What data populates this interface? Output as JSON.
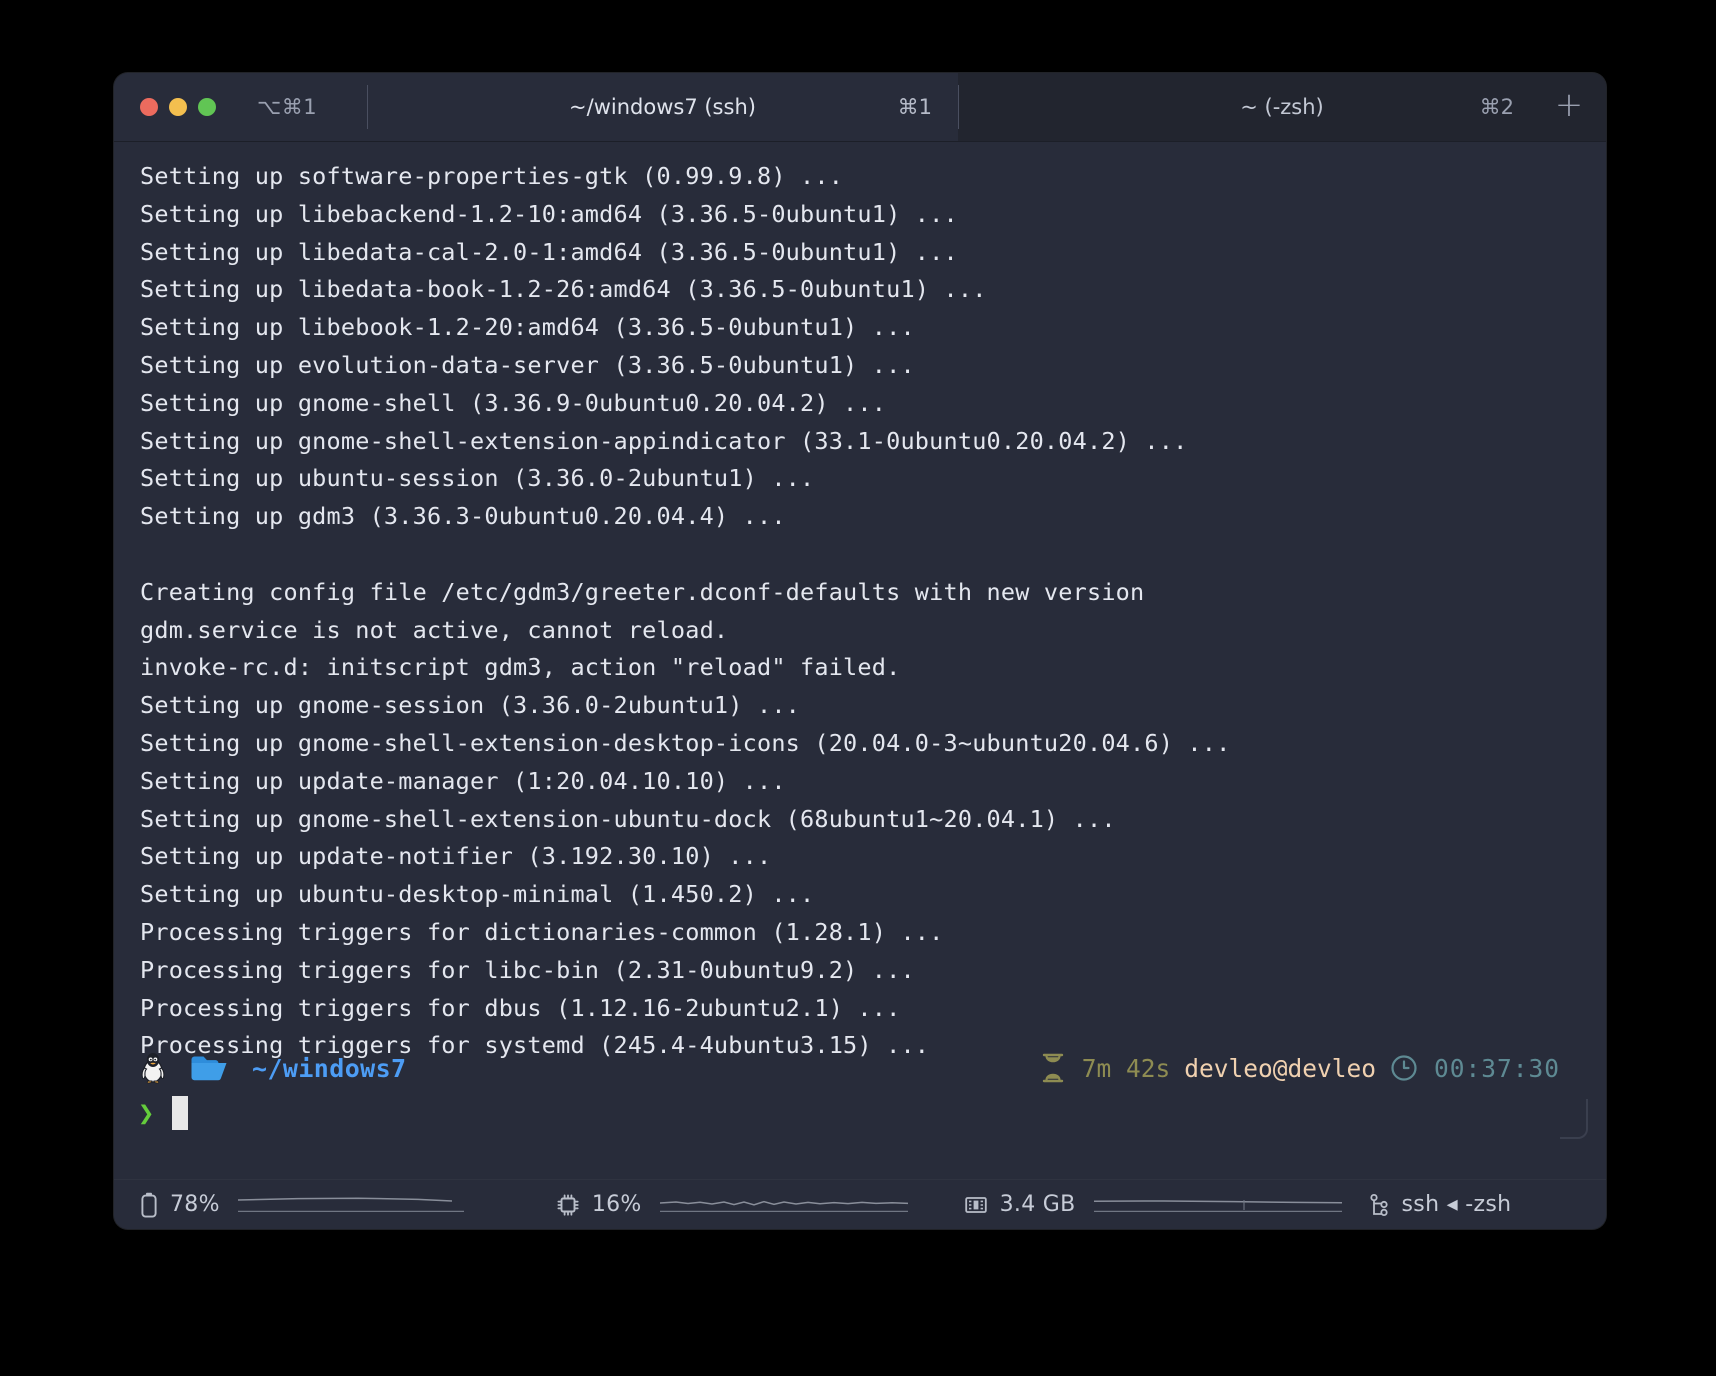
{
  "window": {
    "traffic_lights": [
      {
        "name": "close",
        "color": "#ec6b5e"
      },
      {
        "name": "minimize",
        "color": "#f3bf4f"
      },
      {
        "name": "zoom",
        "color": "#61c554"
      }
    ],
    "window_shortcut": "⌥⌘1",
    "background": "#282c3a"
  },
  "tabs": [
    {
      "title": "~/windows7 (ssh)",
      "shortcut": "⌘1",
      "active": true
    },
    {
      "title": "~ (-zsh)",
      "shortcut": "⌘2",
      "active": false
    }
  ],
  "new_tab_label": "+",
  "terminal": {
    "lines": [
      "Setting up software-properties-gtk (0.99.9.8) ...",
      "Setting up libebackend-1.2-10:amd64 (3.36.5-0ubuntu1) ...",
      "Setting up libedata-cal-2.0-1:amd64 (3.36.5-0ubuntu1) ...",
      "Setting up libedata-book-1.2-26:amd64 (3.36.5-0ubuntu1) ...",
      "Setting up libebook-1.2-20:amd64 (3.36.5-0ubuntu1) ...",
      "Setting up evolution-data-server (3.36.5-0ubuntu1) ...",
      "Setting up gnome-shell (3.36.9-0ubuntu0.20.04.2) ...",
      "Setting up gnome-shell-extension-appindicator (33.1-0ubuntu0.20.04.2) ...",
      "Setting up ubuntu-session (3.36.0-2ubuntu1) ...",
      "Setting up gdm3 (3.36.3-0ubuntu0.20.04.4) ...",
      "",
      "Creating config file /etc/gdm3/greeter.dconf-defaults with new version",
      "gdm.service is not active, cannot reload.",
      "invoke-rc.d: initscript gdm3, action \"reload\" failed.",
      "Setting up gnome-session (3.36.0-2ubuntu1) ...",
      "Setting up gnome-shell-extension-desktop-icons (20.04.0-3~ubuntu20.04.6) ...",
      "Setting up update-manager (1:20.04.10.10) ...",
      "Setting up gnome-shell-extension-ubuntu-dock (68ubuntu1~20.04.1) ...",
      "Setting up update-notifier (3.192.30.10) ...",
      "Setting up ubuntu-desktop-minimal (1.450.2) ...",
      "Processing triggers for dictionaries-common (1.28.1) ...",
      "Processing triggers for libc-bin (2.31-0ubuntu9.2) ...",
      "Processing triggers for dbus (1.12.16-2ubuntu2.1) ...",
      "Processing triggers for systemd (245.4-4ubuntu3.15) ..."
    ]
  },
  "prompt": {
    "os_icon": "tux-penguin-icon",
    "folder_icon": "folder-icon",
    "cwd": "~/windows7",
    "cwd_color": "#4d9df5",
    "hourglass_icon": "hourglass-icon",
    "elapsed": "7m 42s",
    "elapsed_color": "#8e8c52",
    "userhost": "devleo@devleo",
    "userhost_color": "#f0d1b0",
    "clock_icon": "clock-icon",
    "time": "00:37:30",
    "time_color": "#5e8a93",
    "chevron": "❯",
    "chevron_color": "#64cc3c",
    "input_value": ""
  },
  "statusbar": {
    "battery": {
      "icon": "battery-icon",
      "value": "78%"
    },
    "cpu": {
      "icon": "cpu-chip-icon",
      "value": "16%"
    },
    "memory": {
      "icon": "memory-ram-icon",
      "value": "3.4 GB"
    },
    "session": {
      "icon": "git-branch-icon",
      "value": "ssh ◂ -zsh"
    }
  }
}
